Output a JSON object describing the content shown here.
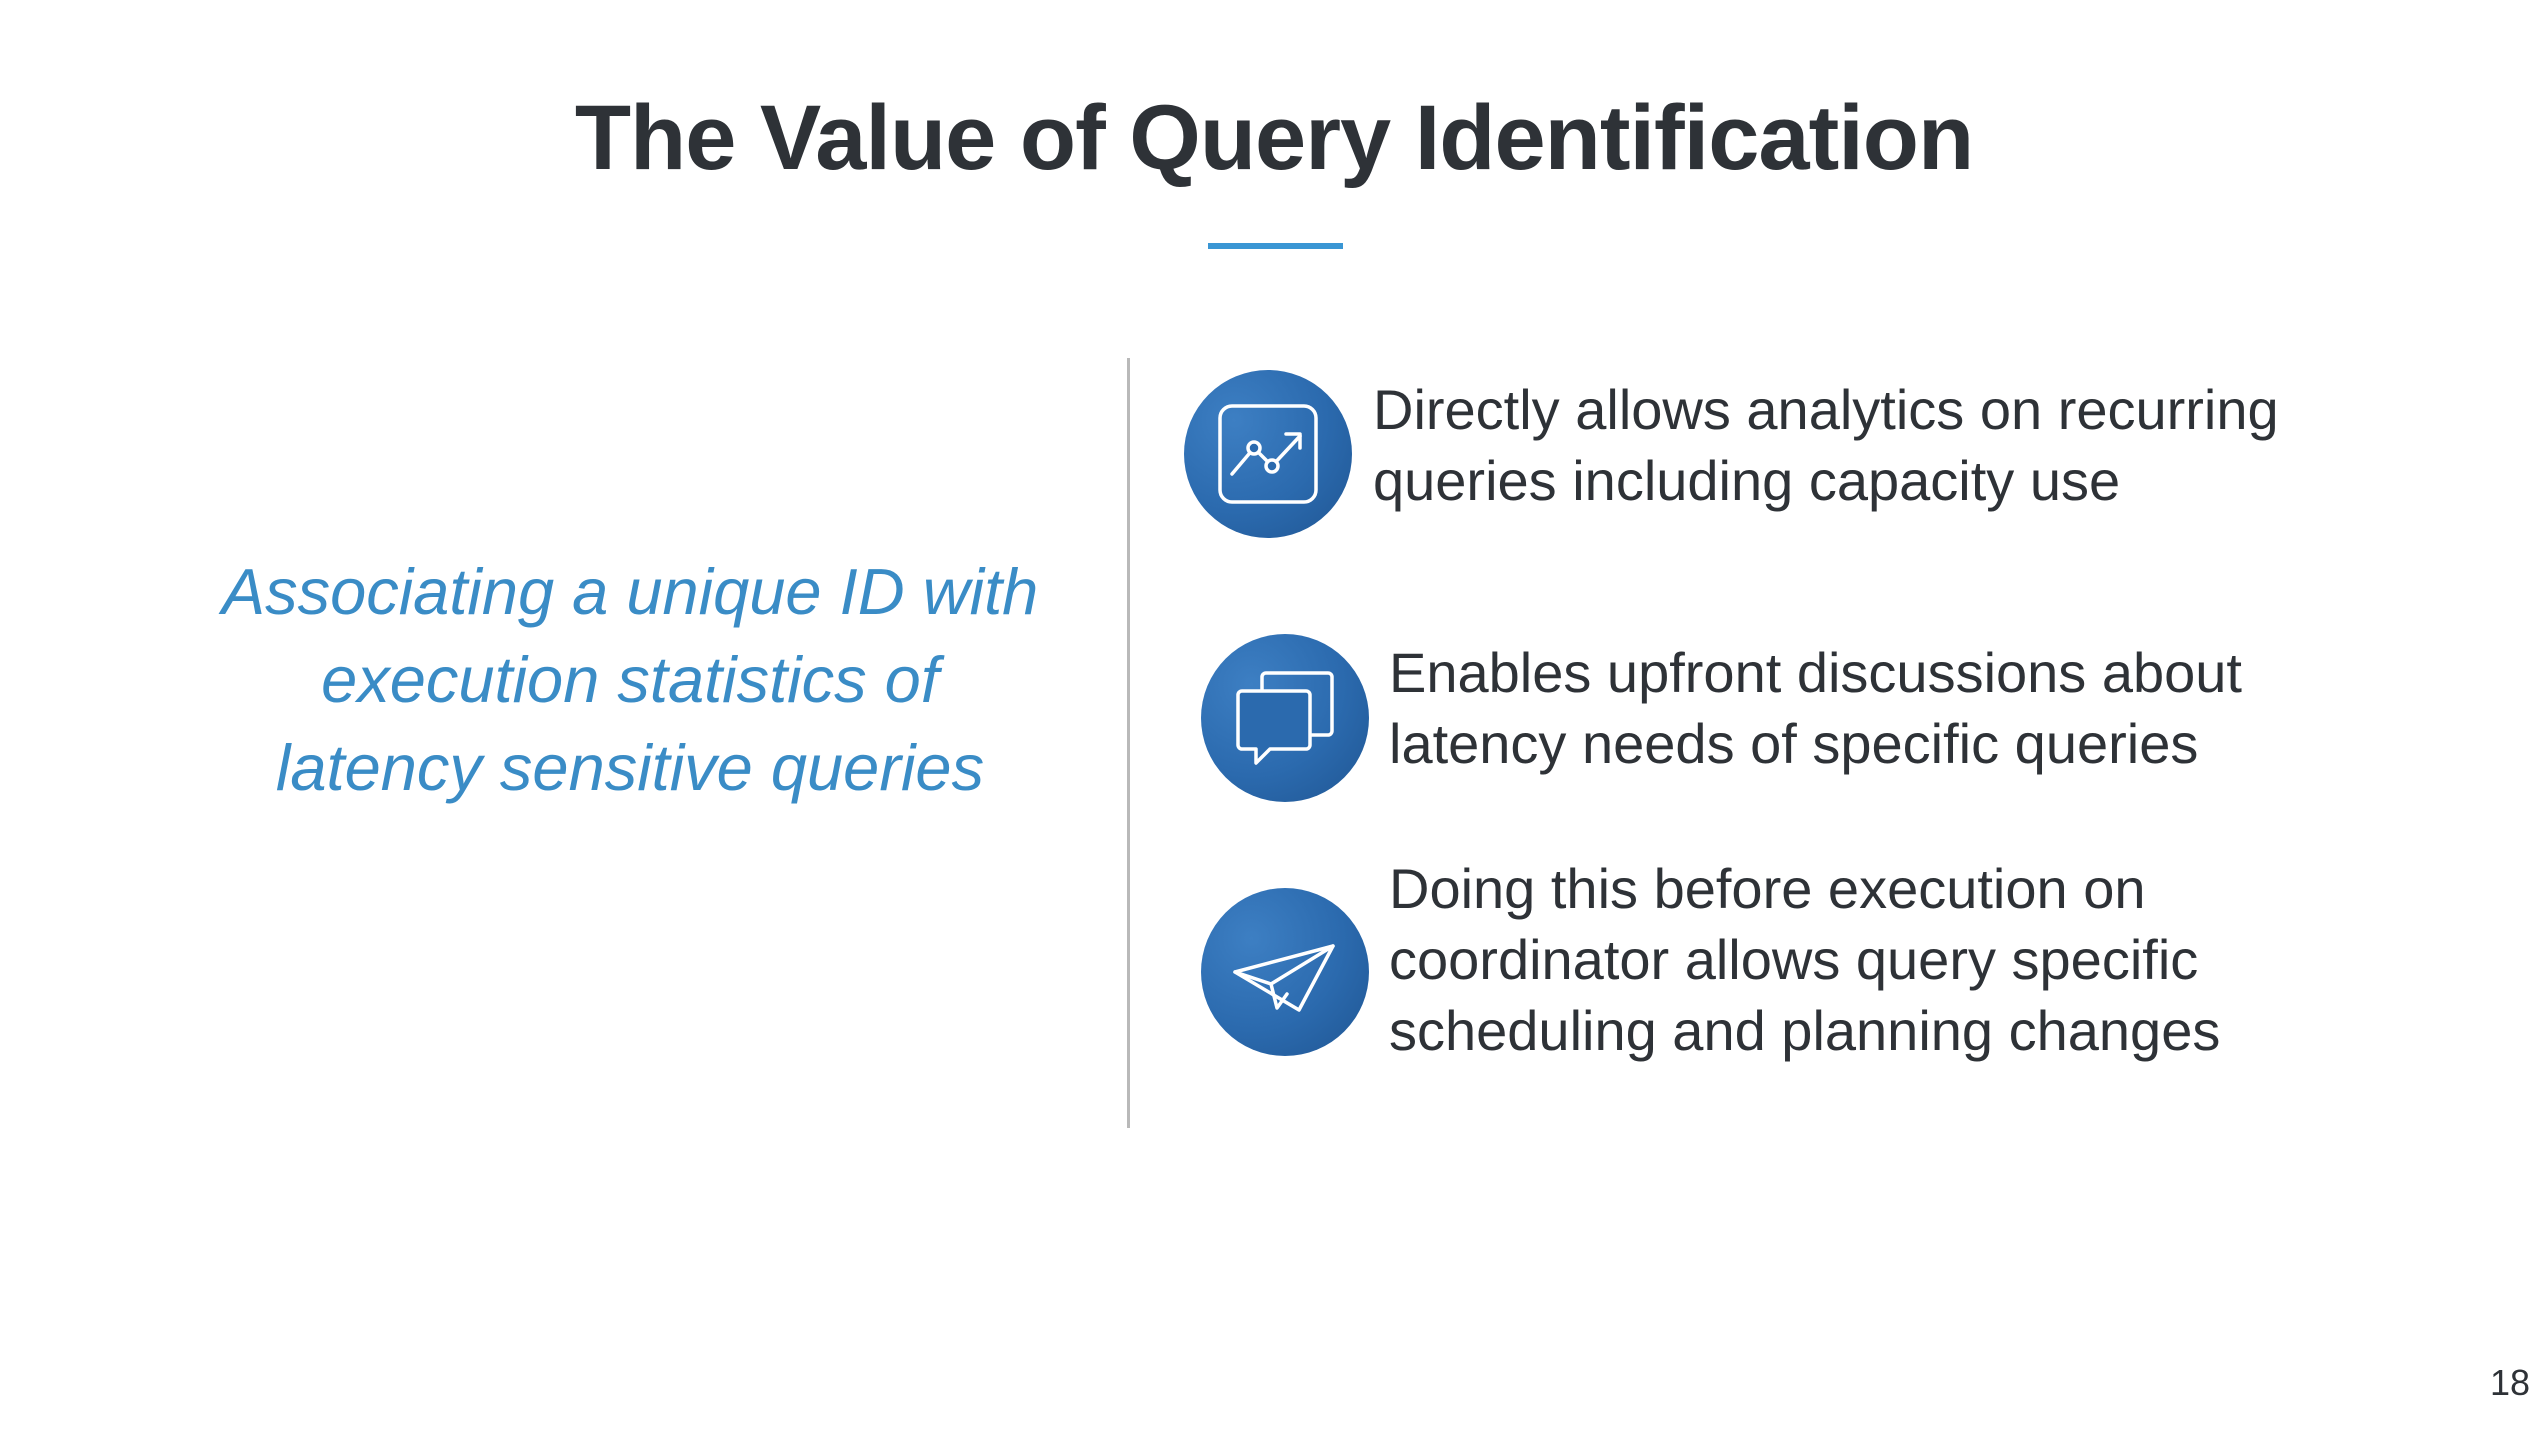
{
  "slide": {
    "title": "The Value of Query Identification",
    "quote_lines": [
      "Associating a unique ID with",
      "execution statistics of",
      "latency sensitive queries"
    ],
    "items": [
      {
        "icon": "analytics-chart-icon",
        "lines": [
          "Directly allows analytics on recurring",
          "queries including capacity use"
        ]
      },
      {
        "icon": "chat-bubbles-icon",
        "lines": [
          "Enables upfront discussions about",
          "latency needs of specific queries"
        ]
      },
      {
        "icon": "paper-plane-icon",
        "lines": [
          "Doing this before execution on",
          "coordinator allows query specific",
          "scheduling  and planning changes"
        ]
      }
    ],
    "page_number": "18"
  },
  "colors": {
    "title_text": "#2e3237",
    "accent_blue": "#3a96d4",
    "quote_text": "#3a8cc6",
    "icon_circle": "#2b6aae",
    "divider": "#b9b9b9"
  }
}
